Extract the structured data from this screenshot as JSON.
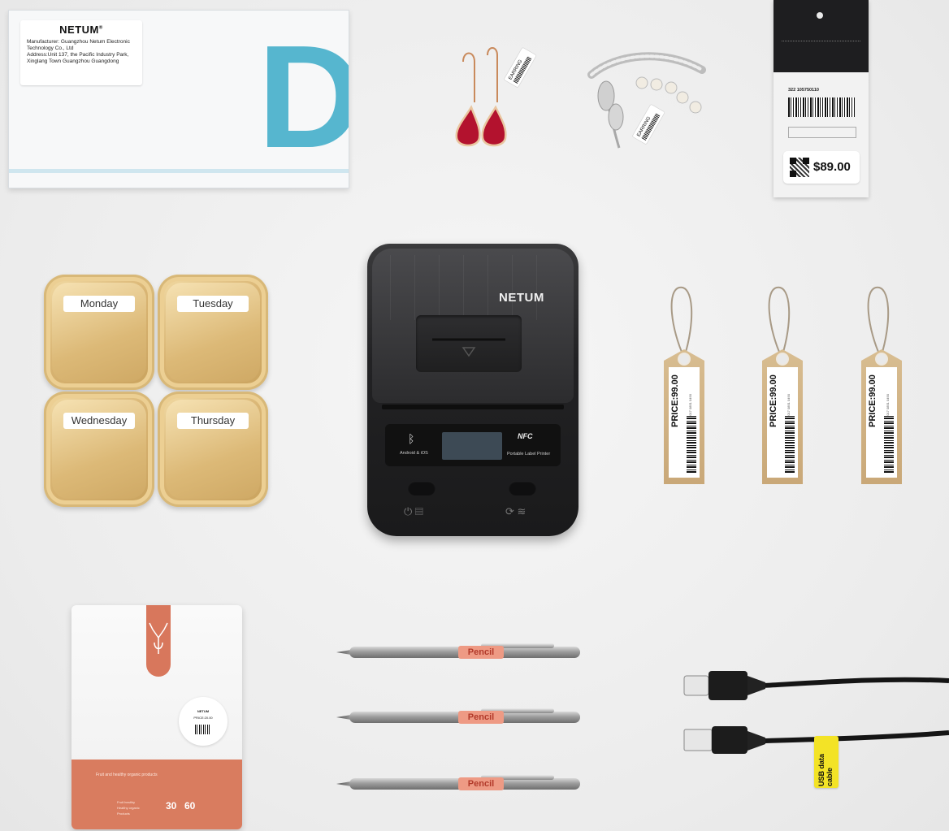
{
  "box": {
    "brand": "NETUM",
    "reg": "®",
    "line1": "Manufacturer: Guangzhou Netum Electronic",
    "line2": "Technology Co., Ltd",
    "line3": "Address:Unit 137, the Pacific Industry Park,",
    "line4": "Xinglang Town Guangzhou Guangdong",
    "big_letter": "D"
  },
  "earring_tag": "EARRING",
  "brooch_tag": "EARRING",
  "price_tag": {
    "code": "322 105750110",
    "price": "$89.00"
  },
  "containers": [
    "Monday",
    "Tuesday",
    "Wednesday",
    "Thursday"
  ],
  "printer": {
    "brand": "NETUM",
    "bt_symbol": "ᛒ",
    "android_text": "Android & iOS",
    "nfc_text": "NFC",
    "portable_text": "Portable Label Printer",
    "left_btn_symbols": "⏻ ▤",
    "right_btn_symbols": "⟳ ≋"
  },
  "hang_tags": [
    {
      "price": "PRICE:99.00",
      "num": "2017 0851 0490"
    },
    {
      "price": "PRICE:99.00",
      "num": "2017 0851 0490"
    },
    {
      "price": "PRICE:99.00",
      "num": "2017 0851 0490"
    }
  ],
  "bag": {
    "sticker_brand": "NETUM",
    "sticker_price": "PRICE:20.00",
    "tagline": "Fruit and healthy organic products",
    "n30": "30",
    "n60": "60",
    "bullets": [
      "Fruit healthy",
      "Healthy organic",
      "Products"
    ]
  },
  "pencil_label": "Pencil",
  "cable_label": "USB data cable"
}
